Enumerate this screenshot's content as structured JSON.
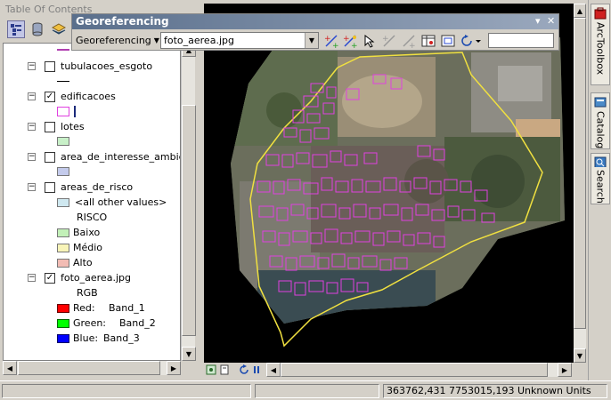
{
  "toc": {
    "title": "Table Of Contents",
    "layers": [
      {
        "name": "tubulacoes_esgoto",
        "checked": false,
        "symbol": "line"
      },
      {
        "name": "edificacoes",
        "checked": true,
        "symbol": "poly-outline"
      },
      {
        "name": "lotes",
        "checked": false,
        "symbol": "fill"
      },
      {
        "name": "area_de_interesse_ambiental",
        "checked": false,
        "symbol": "fill"
      },
      {
        "name": "areas_de_risco",
        "checked": false,
        "symbol": "classes"
      },
      {
        "name": "foto_aerea.jpg",
        "checked": true,
        "symbol": "rgb"
      }
    ],
    "risco_classes": {
      "other": "<all other values>",
      "field": "RISCO",
      "items": [
        "Baixo",
        "Médio",
        "Alto"
      ]
    },
    "rgb": {
      "label": "RGB",
      "bands": [
        {
          "channel": "Red:",
          "band": "Band_1"
        },
        {
          "channel": "Green:",
          "band": "Band_2"
        },
        {
          "channel": "Blue:",
          "band": "Band_3"
        }
      ]
    },
    "colors": {
      "lotes": "#c8f0c8",
      "area_interesse": "#c4cbec",
      "other": "#cfe8f0",
      "baixo": "#c2f0b8",
      "medio": "#f8f4b8",
      "alto": "#f2bcb4",
      "red": "#ff0000",
      "green": "#00ff00",
      "blue": "#0000ff",
      "edif_outline": "#e040e0"
    }
  },
  "georef": {
    "title": "Georeferencing",
    "menu_label": "Georeferencing",
    "layer_value": "foto_aerea.jpg",
    "tools": [
      "add-control-points-icon",
      "auto-registration-icon",
      "select-link-icon",
      "zoom-to-selected-link-icon",
      "delete-link-icon",
      "view-link-table-icon",
      "fit-to-display-icon",
      "rotate-icon",
      "scale-input"
    ]
  },
  "dock": {
    "tabs": [
      "ArcToolbox",
      "Catalog",
      "Search"
    ]
  },
  "status": {
    "coords": "363762,431  7753015,193 Unknown Units"
  }
}
